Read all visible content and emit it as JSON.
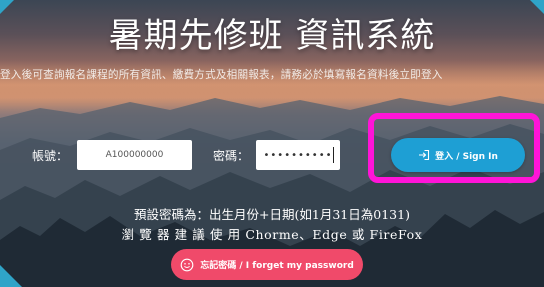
{
  "page": {
    "title": "暑期先修班 資訊系統",
    "subtitle": "登入後可查詢報名課程的所有資訊、繳費方式及相關報表，請務必於填寫報名資料後立即登入",
    "colors": {
      "signin_button": "#1e9fd4",
      "forget_button": "#f04a6a",
      "highlight_box": "#ff14d8"
    }
  },
  "login": {
    "account_label": "帳號：",
    "account_value": "A100000000",
    "password_label": "密碼：",
    "password_mask": "••••••••••",
    "signin_icon": "sign-in-icon",
    "signin_label": "登入 / Sign In"
  },
  "hints": {
    "password_hint": "預設密碼為：出生月份+日期(如1月31日為0131)",
    "browser_hint": "瀏 覽 器 建 議 使 用 Chorme、Edge 或 FireFox"
  },
  "forget": {
    "icon": "smile-icon",
    "label": "忘記密碼 / I forget my password"
  }
}
